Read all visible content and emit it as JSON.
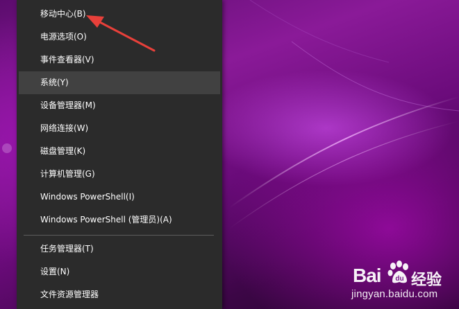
{
  "menu": {
    "items": [
      {
        "label": "移动中心(B)"
      },
      {
        "label": "电源选项(O)"
      },
      {
        "label": "事件查看器(V)"
      },
      {
        "label": "系统(Y)"
      },
      {
        "label": "设备管理器(M)"
      },
      {
        "label": "网络连接(W)"
      },
      {
        "label": "磁盘管理(K)"
      },
      {
        "label": "计算机管理(G)"
      },
      {
        "label": "Windows PowerShell(I)"
      },
      {
        "label": "Windows PowerShell (管理员)(A)"
      },
      {
        "label": "任务管理器(T)"
      },
      {
        "label": "设置(N)"
      },
      {
        "label": "文件资源管理器"
      }
    ],
    "highlighted_item": "系统(Y)"
  },
  "annotation": {
    "type": "red-arrow-icon",
    "color": "#e8403a",
    "points_to": "移动中心(B)"
  },
  "watermark": {
    "brand": "Bai",
    "suffix": "经验",
    "url": "jingyan.baidu.com"
  },
  "colors": {
    "menu_background": "#2b2b2b",
    "menu_highlight": "#414141",
    "menu_text": "#ffffff",
    "wallpaper_accent": "#8a1a98"
  }
}
